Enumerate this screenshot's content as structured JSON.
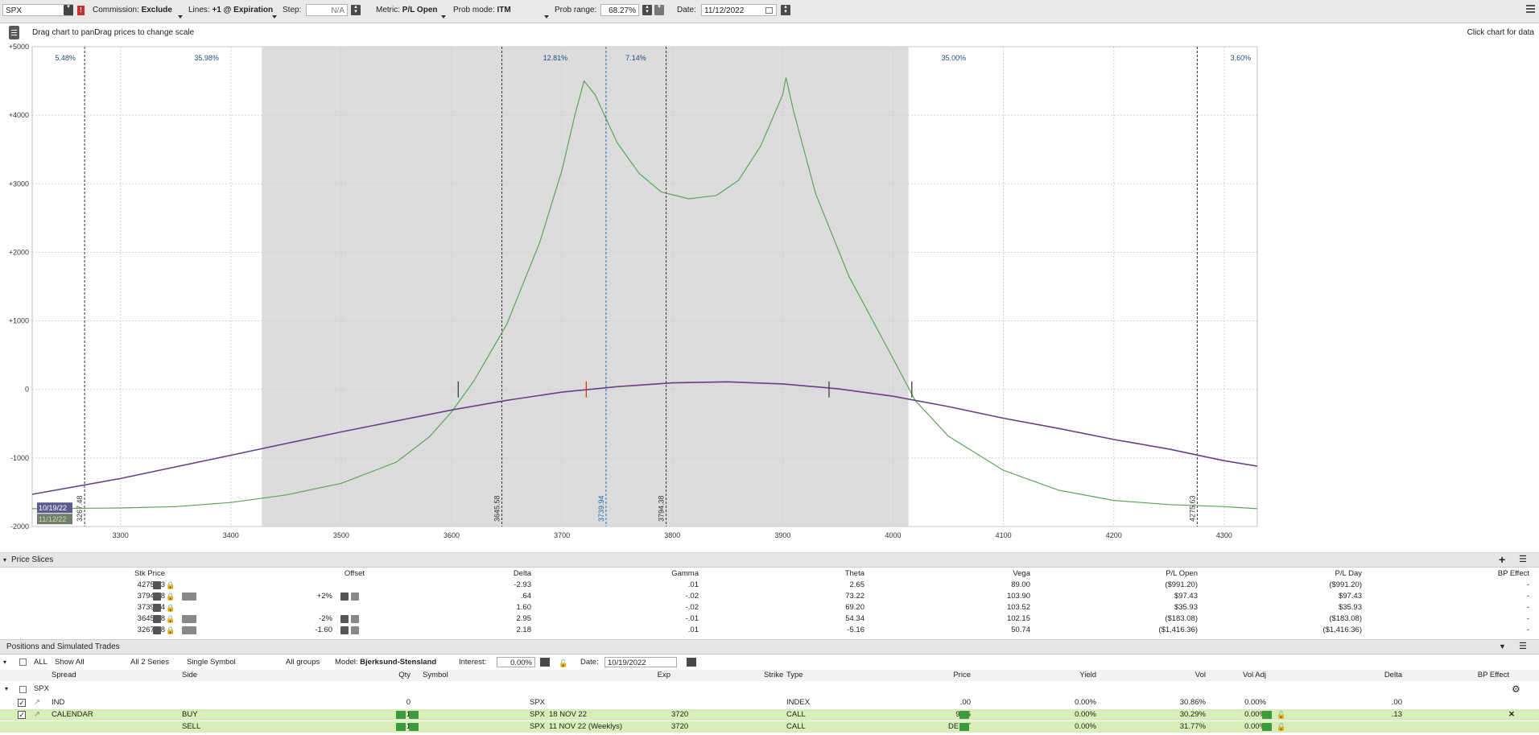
{
  "toolbar": {
    "symbol": "SPX",
    "commission_label": "Commission:",
    "commission_value": "Exclude",
    "lines_label": "Lines:",
    "lines_value": "+1 @ Expiration",
    "step_label": "Step:",
    "step_value": "N/A",
    "metric_label": "Metric:",
    "metric_value": "P/L Open",
    "probmode_label": "Prob mode:",
    "probmode_value": "ITM",
    "probrange_label": "Prob range:",
    "probrange_value": "68.27%",
    "date_label": "Date:",
    "date_value": "11/12/2022"
  },
  "hint": {
    "left": "Drag chart to panDrag prices to change scale",
    "right": "Click chart for data"
  },
  "chart_data": {
    "type": "line",
    "x_ticks": [
      3300,
      3400,
      3500,
      3600,
      3700,
      3800,
      3900,
      4000,
      4100,
      4200,
      4300
    ],
    "y_ticks": [
      5000,
      4000,
      3000,
      2000,
      1000,
      0,
      -1000,
      -2000
    ],
    "y_tick_labels": [
      "+5000",
      "+4000",
      "+3000",
      "+2000",
      "+1000",
      "0",
      "-1000",
      "-2000"
    ],
    "xlim": [
      3220,
      4330
    ],
    "ylim": [
      -2000,
      5000
    ],
    "shaded_range": [
      3428,
      4014
    ],
    "prob_labels": [
      {
        "text": "5.48%",
        "x": 3250
      },
      {
        "text": "35.98%",
        "x": 3378
      },
      {
        "text": "12.81%",
        "x": 3694
      },
      {
        "text": "7.14%",
        "x": 3767
      },
      {
        "text": "35.00%",
        "x": 4055
      },
      {
        "text": "3.60%",
        "x": 4315
      }
    ],
    "price_lines": [
      {
        "label": "3267.48",
        "x": 3267.48,
        "color": "#333333"
      },
      {
        "label": "3645.58",
        "x": 3645.58,
        "color": "#333333"
      },
      {
        "label": "3739.94",
        "x": 3739.94,
        "color": "#1b6fb5"
      },
      {
        "label": "3794.38",
        "x": 3794.38,
        "color": "#333333"
      },
      {
        "label": "4275.63",
        "x": 4275.63,
        "color": "#333333"
      }
    ],
    "series": [
      {
        "name": "11/12/2022",
        "color": "#5aa55a",
        "points": [
          [
            3220,
            -1740
          ],
          [
            3300,
            -1730
          ],
          [
            3350,
            -1710
          ],
          [
            3400,
            -1650
          ],
          [
            3450,
            -1540
          ],
          [
            3500,
            -1370
          ],
          [
            3550,
            -1060
          ],
          [
            3580,
            -690
          ],
          [
            3600,
            -330
          ],
          [
            3620,
            120
          ],
          [
            3650,
            950
          ],
          [
            3680,
            2150
          ],
          [
            3700,
            3200
          ],
          [
            3712,
            4020
          ],
          [
            3720,
            4500
          ],
          [
            3730,
            4300
          ],
          [
            3750,
            3600
          ],
          [
            3770,
            3150
          ],
          [
            3790,
            2880
          ],
          [
            3815,
            2780
          ],
          [
            3840,
            2830
          ],
          [
            3860,
            3050
          ],
          [
            3880,
            3550
          ],
          [
            3900,
            4300
          ],
          [
            3903,
            4550
          ],
          [
            3910,
            4050
          ],
          [
            3930,
            2850
          ],
          [
            3960,
            1650
          ],
          [
            4000,
            450
          ],
          [
            4020,
            -160
          ],
          [
            4050,
            -680
          ],
          [
            4100,
            -1180
          ],
          [
            4150,
            -1470
          ],
          [
            4200,
            -1620
          ],
          [
            4250,
            -1680
          ],
          [
            4300,
            -1710
          ],
          [
            4330,
            -1740
          ]
        ]
      },
      {
        "name": "10/19/2022",
        "color": "#6a3f86",
        "points": [
          [
            3220,
            -1530
          ],
          [
            3300,
            -1300
          ],
          [
            3400,
            -960
          ],
          [
            3500,
            -620
          ],
          [
            3600,
            -300
          ],
          [
            3650,
            -160
          ],
          [
            3700,
            -40
          ],
          [
            3750,
            40
          ],
          [
            3800,
            95
          ],
          [
            3850,
            110
          ],
          [
            3900,
            80
          ],
          [
            3950,
            10
          ],
          [
            4000,
            -100
          ],
          [
            4050,
            -250
          ],
          [
            4100,
            -420
          ],
          [
            4150,
            -570
          ],
          [
            4200,
            -730
          ],
          [
            4250,
            -870
          ],
          [
            4300,
            -1040
          ],
          [
            4330,
            -1120
          ]
        ]
      }
    ],
    "markers": [
      {
        "x": 3606,
        "y": 0,
        "color": "#333333"
      },
      {
        "x": 3722,
        "y": 0,
        "color": "#d62b1f"
      },
      {
        "x": 3942,
        "y": 0,
        "color": "#333333"
      },
      {
        "x": 4017,
        "y": 0,
        "color": "#333333"
      }
    ],
    "legend": [
      {
        "text": "10/19/22",
        "color": "#6a3f86"
      },
      {
        "text": "11/12/22",
        "color": "#5aa55a"
      }
    ]
  },
  "price_slices": {
    "title": "Price Slices",
    "columns": [
      "Stk Price",
      "Offset",
      "Delta",
      "Gamma",
      "Theta",
      "Vega",
      "P/L Open",
      "P/L Day",
      "BP Effect"
    ],
    "rows": [
      {
        "stk": "4275.63",
        "offset": "",
        "delta": "-2.93",
        "gamma": ".01",
        "theta": "2.65",
        "vega": "89.00",
        "plopen": "($991.20)",
        "plday": "($991.20)",
        "bp": "-"
      },
      {
        "stk": "3794.38",
        "offset": "+2%",
        "delta": ".64",
        "gamma": "-.02",
        "theta": "73.22",
        "vega": "103.90",
        "plopen": "$97.43",
        "plday": "$97.43",
        "bp": "-"
      },
      {
        "stk": "3739.94",
        "offset": "",
        "delta": "1.60",
        "gamma": "-.02",
        "theta": "69.20",
        "vega": "103.52",
        "plopen": "$35.93",
        "plday": "$35.93",
        "bp": "-"
      },
      {
        "stk": "3645.58",
        "offset": "-2%",
        "delta": "2.95",
        "gamma": "-.01",
        "theta": "54.34",
        "vega": "102.15",
        "plopen": "($183.08)",
        "plday": "($183.08)",
        "bp": "-"
      },
      {
        "stk": "3267.48",
        "offset": "-1.60",
        "delta": "2.18",
        "gamma": ".01",
        "theta": "-5.16",
        "vega": "50.74",
        "plopen": "($1,416.36)",
        "plday": "($1,416.36)",
        "bp": "-"
      }
    ]
  },
  "positions": {
    "title": "Positions and Simulated Trades",
    "filter": {
      "all_label": "ALL",
      "show_all": "Show All",
      "series": "All 2 Series",
      "symbol_mode": "Single Symbol",
      "groups": "All groups",
      "model_label": "Model:",
      "model_value": "Bjerksund-Stensland",
      "interest_label": "Interest:",
      "interest_value": "0.00%",
      "date_label": "Date:",
      "date_value": "10/19/2022"
    },
    "columns": [
      "Spread",
      "Side",
      "Qty",
      "Symbol",
      "Exp",
      "Strike",
      "Type",
      "Price",
      "Yield",
      "Vol",
      "Vol Adj",
      "Delta",
      "BP Effect"
    ],
    "group": "SPX",
    "rows": [
      {
        "spread": "IND",
        "side": "",
        "qty": "0",
        "symbol": "SPX",
        "exp": "",
        "strike": "",
        "type": "INDEX",
        "price": ".00",
        "yield": "0.00%",
        "vol": "30.86%",
        "voladj": "0.00%",
        "delta": ".00"
      },
      {
        "spread": "CALENDAR",
        "side": "BUY",
        "qty": "+1",
        "symbol": "SPX",
        "exp": "18 NOV 22",
        "strike": "3720",
        "type": "CALL",
        "price": "9.65",
        "yield": "0.00%",
        "vol": "30.29%",
        "voladj": "0.00%",
        "delta": ".13"
      },
      {
        "spread": "",
        "side": "SELL",
        "qty": "-1",
        "symbol": "SPX",
        "exp": "11 NOV 22 (Weeklys)",
        "strike": "3720",
        "type": "CALL",
        "price": "DEBIT",
        "yield": "0.00%",
        "vol": "31.77%",
        "voladj": "0.00%",
        "delta": ""
      }
    ]
  }
}
